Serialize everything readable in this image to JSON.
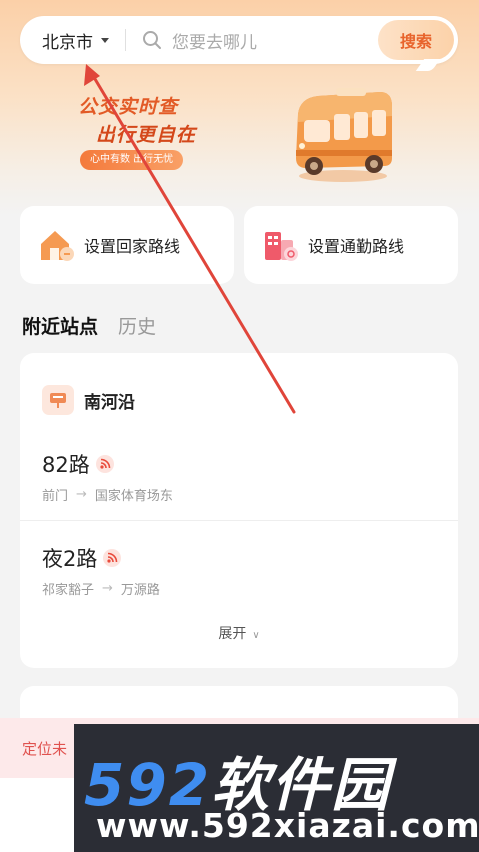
{
  "search": {
    "city": "北京市",
    "placeholder": "您要去哪儿",
    "button": "搜索"
  },
  "banner": {
    "line1": "公交实时查",
    "line2": "出行更自在",
    "pill": "心中有数 出行无忧"
  },
  "shortcuts": {
    "home_label": "设置回家路线",
    "work_label": "设置通勤路线"
  },
  "tabs": [
    {
      "label": "附近站点",
      "active": true
    },
    {
      "label": "历史",
      "active": false
    }
  ],
  "station": {
    "name": "南河沿",
    "routes": [
      {
        "name": "82路",
        "from": "前门",
        "to": "国家体育场东"
      },
      {
        "name": "夜2路",
        "from": "祁家豁子",
        "to": "万源路"
      }
    ],
    "expand_label": "展开"
  },
  "location_toast": "定位未",
  "watermark": {
    "main_digits": "592",
    "main_text": "软件园",
    "url": "www.592xiazai.com"
  },
  "colors": {
    "accent": "#e8642c",
    "annotation": "#e0453a",
    "watermark_blue": "#3f8df0"
  }
}
